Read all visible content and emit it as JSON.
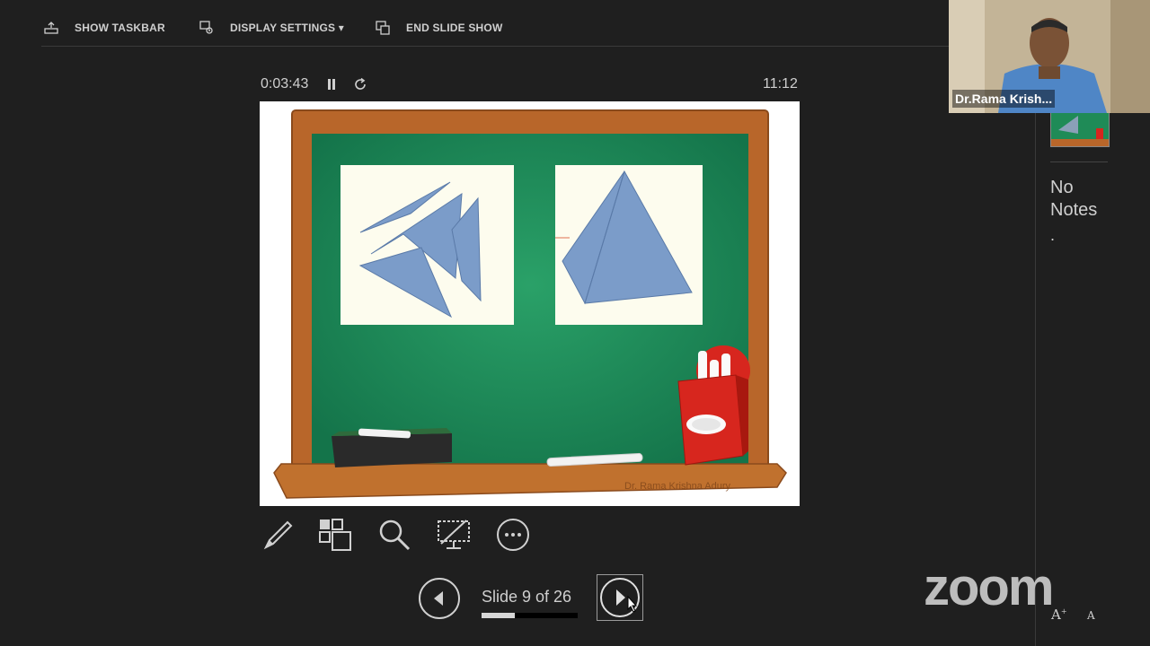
{
  "toolbar": {
    "show_taskbar": "SHOW TASKBAR",
    "display_settings": "DISPLAY SETTINGS ▾",
    "end_slide_show": "END SLIDE SHOW"
  },
  "presenter": {
    "elapsed": "0:03:43",
    "clock": "11:12",
    "slide_counter": "Slide 9 of 26",
    "progress_fraction": 0.346
  },
  "slide": {
    "credit": "Dr. Rama Krishna Adury"
  },
  "notes": {
    "text": "No Notes",
    "trailing": "."
  },
  "video": {
    "participant_name": "Dr.Rama Krish..."
  },
  "branding": {
    "logo_text": "zoom",
    "font_increase": "A",
    "font_decrease": "A"
  },
  "colors": {
    "background": "#1f1f1f",
    "board_green": "#1f8b57",
    "frame_wood": "#b8662a",
    "shape_blue": "#7b9cc9",
    "paper": "#fdfcee",
    "chalk_box_red": "#d7261e"
  }
}
